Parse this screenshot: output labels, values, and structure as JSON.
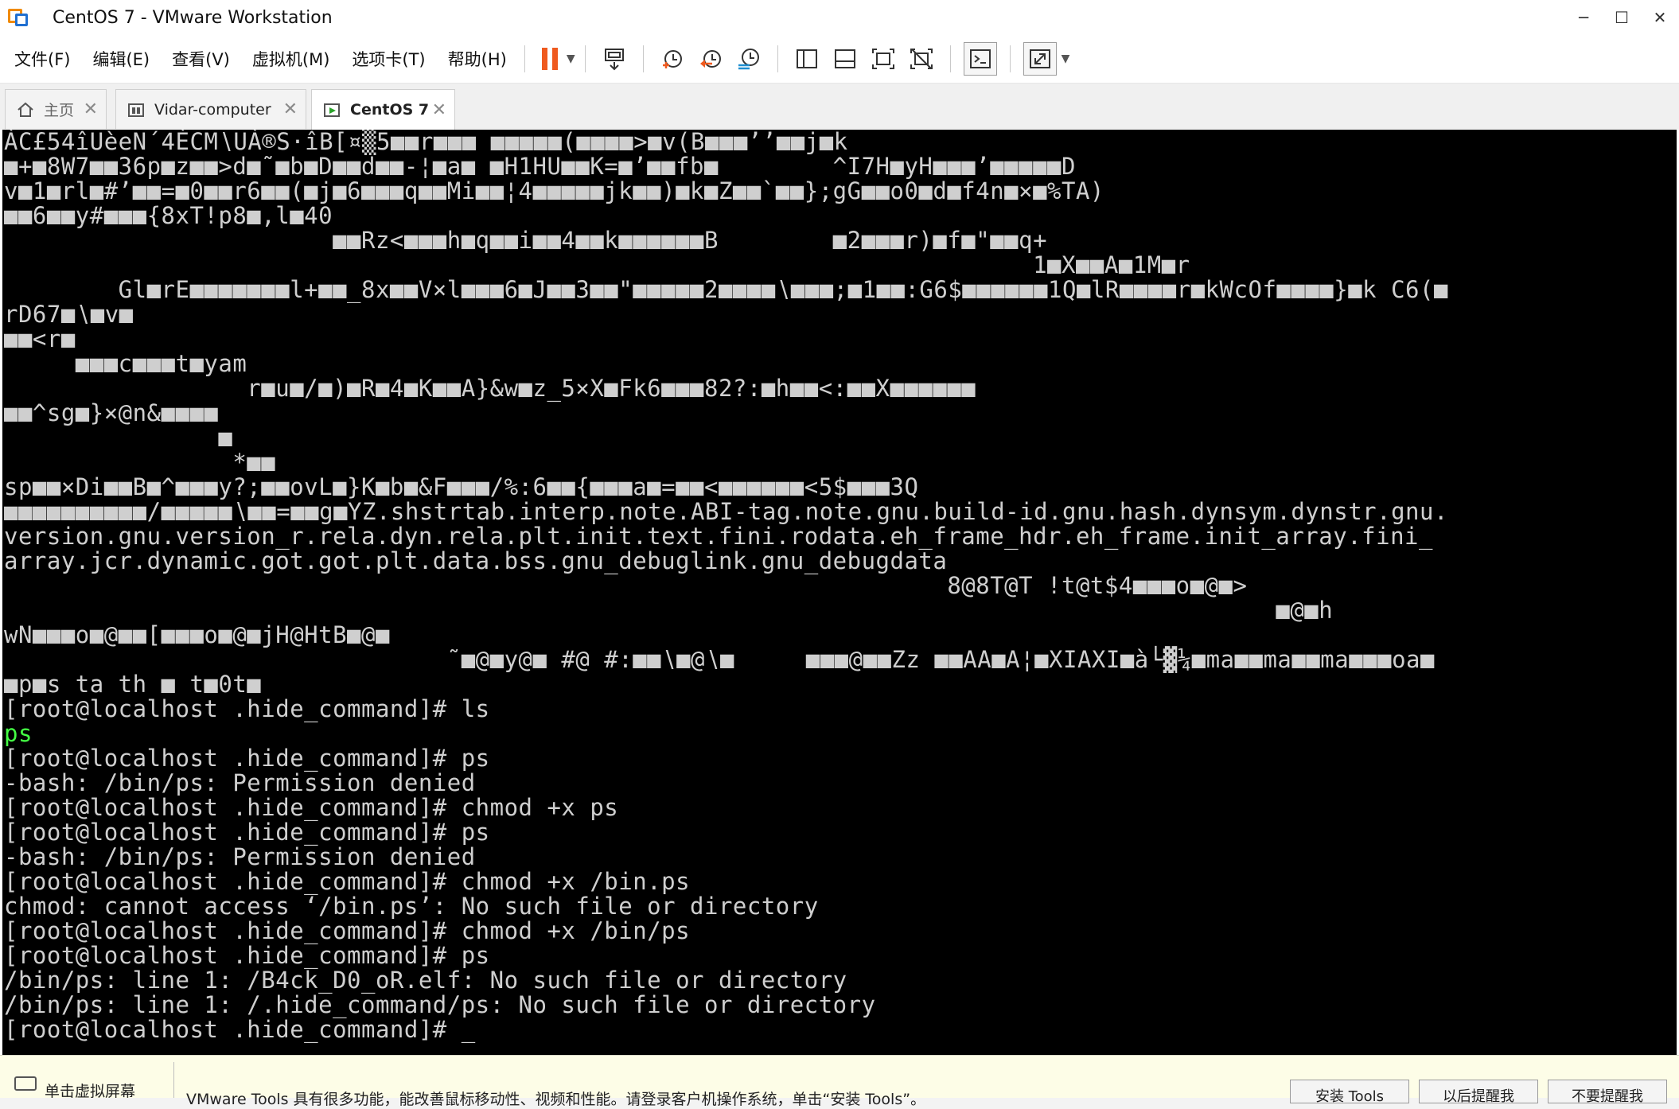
{
  "window": {
    "title": "CentOS 7 - VMware Workstation",
    "controls": [
      "─",
      "☐",
      "✕"
    ]
  },
  "menu": [
    "文件(F)",
    "编辑(E)",
    "查看(V)",
    "虚拟机(M)",
    "选项卡(T)",
    "帮助(H)"
  ],
  "toolbar": {
    "icons": [
      "pause-icon",
      "send-ctrl-alt-del-icon",
      "snapshot-icon",
      "revert-snapshot-icon",
      "snapshot-manager-icon",
      "sidebar-icon",
      "thumbnail-bar-icon",
      "fullscreen-icon",
      "unity-icon",
      "console-view-icon",
      "stretch-icon"
    ],
    "accent": "#ef5a1f"
  },
  "tabs": [
    {
      "label": "主页",
      "icon": "home-icon",
      "active": false
    },
    {
      "label": "Vidar-computer",
      "icon": "vm-icon",
      "active": false
    },
    {
      "label": "CentOS 7",
      "icon": "vm-running-icon",
      "active": true
    }
  ],
  "console": {
    "lines": [
      "ÀC£54îUèeN´4ÈCM∖UÀ®S·îB[¤▒5■■r■■■ ■■■■■(■■■■>■v(B■■■’’■■j■k",
      "■+■8W7■■36p■z■■>d■˜■b■D■■d■■-¦■a■ ■H1HU■■K=■’■■fb■        ^I7H■yH■■■’■■■■■D",
      "v■1■rl■#’■■=■0■■r6■■(■j■6■■■q■■Mi■■¦4■■■■■jk■■)■k■Z■■`■■};gG■■o0■d■f4n■×■%TA)",
      "■■6■■y#■■■{8xT!p8■,l■40",
      "                       ■■Rz<■■■h■q■■i■■4■■k■■■■■■B        ■2■■■r)■f■\"■■q+",
      "                                                                        1■X■■A■1M■r",
      "        Gl■rE■■■■■■■l+■■_8x■■V×l■■■6■J■■3■■\"■■■■■2■■■■∖■■■;■1■■:G6$■■■■■■1Q■lR■■■■r■kWcOf■■■■}■k C6(■",
      "rD67■∖■v■",
      "■■<r■",
      "     ■■■c■■■t■yam",
      "                 r■u■/■)■R■4■K■■A}&w■z_5×X■Fk6■■■82?:■h■■<:■■X■■■■■■",
      "■■^sg■}×@n&■■■■",
      "               ■",
      "                *■■",
      "sp■■×Di■■B■^■■■y?;■■ovL■}K■b■&F■■■/%:6■■{■■■a■=■■<■■■■■■<5$■■■3Q",
      "■■■■■■■■■■/■■■■■∖■■=■■g■YZ.shstrtab.interp.note.ABI-tag.note.gnu.build-id.gnu.hash.dynsym.dynstr.gnu.",
      "version.gnu.version_r.rela.dyn.rela.plt.init.text.fini.rodata.eh_frame_hdr.eh_frame.init_array.fini_",
      "array.jcr.dynamic.got.got.plt.data.bss.gnu_debuglink.gnu_debugdata",
      "                                                                  8@8T@T !t@t$4■■■o■@■>",
      "                                                                                         ■@■h",
      "wN■■■o■@■■[■■■o■@■jH@HtB■@■",
      "                               ˜■@■y@■ #@ #:■■∖■@∖■     ■■■@■■Zz ■■AA■A¦■XIAXI■à└▓¼■ma■■ma■■ma■■■oa■",
      "■p■s ta th ■ t■0t■",
      "[root@localhost .hide_command]# ls",
      "ps",
      "[root@localhost .hide_command]# ps",
      "-bash: /bin/ps: Permission denied",
      "[root@localhost .hide_command]# chmod +x ps",
      "[root@localhost .hide_command]# ps",
      "-bash: /bin/ps: Permission denied",
      "[root@localhost .hide_command]# chmod +x /bin.ps",
      "chmod: cannot access ‘/bin.ps’: No such file or directory",
      "[root@localhost .hide_command]# chmod +x /bin/ps",
      "[root@localhost .hide_command]# ps",
      "/bin/ps: line 1: /B4ck_D0_oR.elf: No such file or directory",
      "/bin/ps: line 1: /.hide_command/ps: No such file or directory",
      "[root@localhost .hide_command]# _"
    ],
    "green_line_index": 24,
    "text_color": "#cfcfcf",
    "highlight_color": "#44ff44"
  },
  "hintbar": {
    "left_text": "单击虚拟屏幕",
    "message": "VMware Tools 具有很多功能，能改善鼠标移动性、视频和性能。请登录客户机操作系统，单击“安装 Tools”。",
    "buttons": [
      "安装 Tools",
      "以后提醒我",
      "不要提醒我"
    ]
  }
}
